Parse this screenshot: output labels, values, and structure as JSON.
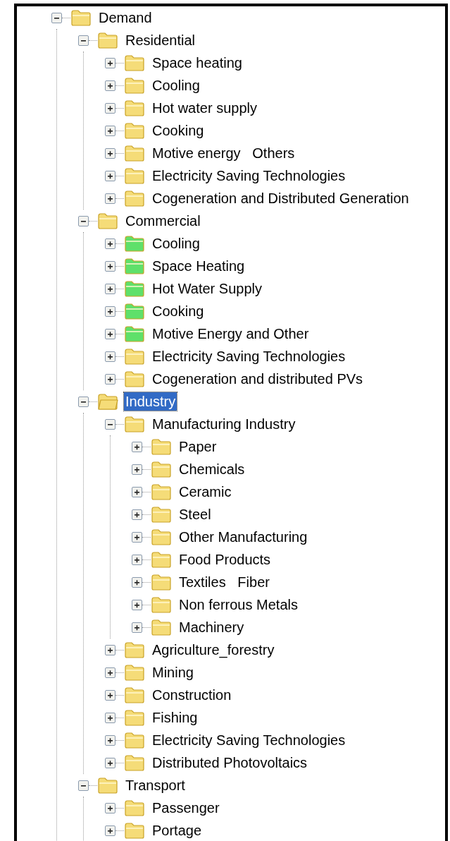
{
  "tree": [
    {
      "label": "Demand",
      "expanded": true,
      "selected": false,
      "color": "#f5dc78",
      "children": [
        {
          "label": "Residential",
          "expanded": true,
          "selected": false,
          "color": "#f5dc78",
          "children": [
            {
              "label": "Space heating",
              "expanded": false,
              "selected": false,
              "color": "#f5dc78"
            },
            {
              "label": "Cooling",
              "expanded": false,
              "selected": false,
              "color": "#f5dc78"
            },
            {
              "label": "Hot water supply",
              "expanded": false,
              "selected": false,
              "color": "#f5dc78"
            },
            {
              "label": "Cooking",
              "expanded": false,
              "selected": false,
              "color": "#f5dc78"
            },
            {
              "label": "Motive energy   Others",
              "expanded": false,
              "selected": false,
              "color": "#f5dc78"
            },
            {
              "label": "Electricity Saving Technologies",
              "expanded": false,
              "selected": false,
              "color": "#f5dc78"
            },
            {
              "label": "Cogeneration and Distributed Generation",
              "expanded": false,
              "selected": false,
              "color": "#f5dc78"
            }
          ]
        },
        {
          "label": "Commercial",
          "expanded": true,
          "selected": false,
          "color": "#f5dc78",
          "children": [
            {
              "label": "Cooling",
              "expanded": false,
              "selected": false,
              "color": "#5fe06a"
            },
            {
              "label": "Space Heating",
              "expanded": false,
              "selected": false,
              "color": "#5fe06a"
            },
            {
              "label": "Hot Water Supply",
              "expanded": false,
              "selected": false,
              "color": "#5fe06a"
            },
            {
              "label": "Cooking",
              "expanded": false,
              "selected": false,
              "color": "#5fe06a"
            },
            {
              "label": "Motive Energy and Other",
              "expanded": false,
              "selected": false,
              "color": "#5fe06a"
            },
            {
              "label": "Electricity Saving Technologies",
              "expanded": false,
              "selected": false,
              "color": "#f5dc78"
            },
            {
              "label": "Cogeneration and distributed PVs",
              "expanded": false,
              "selected": false,
              "color": "#f5dc78"
            }
          ]
        },
        {
          "label": "Industry",
          "expanded": true,
          "selected": true,
          "color": "#f5dc78",
          "children": [
            {
              "label": "Manufacturing Industry",
              "expanded": true,
              "selected": false,
              "color": "#f5dc78",
              "children": [
                {
                  "label": "Paper",
                  "expanded": false,
                  "selected": false,
                  "color": "#f5dc78"
                },
                {
                  "label": "Chemicals",
                  "expanded": false,
                  "selected": false,
                  "color": "#f5dc78"
                },
                {
                  "label": "Ceramic",
                  "expanded": false,
                  "selected": false,
                  "color": "#f5dc78"
                },
                {
                  "label": "Steel",
                  "expanded": false,
                  "selected": false,
                  "color": "#f5dc78"
                },
                {
                  "label": "Other Manufacturing",
                  "expanded": false,
                  "selected": false,
                  "color": "#f5dc78"
                },
                {
                  "label": "Food Products",
                  "expanded": false,
                  "selected": false,
                  "color": "#f5dc78"
                },
                {
                  "label": "Textiles   Fiber",
                  "expanded": false,
                  "selected": false,
                  "color": "#f5dc78"
                },
                {
                  "label": "Non ferrous Metals",
                  "expanded": false,
                  "selected": false,
                  "color": "#f5dc78"
                },
                {
                  "label": "Machinery",
                  "expanded": false,
                  "selected": false,
                  "color": "#f5dc78"
                }
              ]
            },
            {
              "label": "Agriculture_forestry",
              "expanded": false,
              "selected": false,
              "color": "#f5dc78"
            },
            {
              "label": "Mining",
              "expanded": false,
              "selected": false,
              "color": "#f5dc78"
            },
            {
              "label": "Construction",
              "expanded": false,
              "selected": false,
              "color": "#f5dc78"
            },
            {
              "label": "Fishing",
              "expanded": false,
              "selected": false,
              "color": "#f5dc78"
            },
            {
              "label": "Electricity Saving Technologies",
              "expanded": false,
              "selected": false,
              "color": "#f5dc78"
            },
            {
              "label": "Distributed Photovoltaics",
              "expanded": false,
              "selected": false,
              "color": "#f5dc78"
            }
          ]
        },
        {
          "label": "Transport",
          "expanded": true,
          "selected": false,
          "color": "#f5dc78",
          "children": [
            {
              "label": "Passenger",
              "expanded": false,
              "selected": false,
              "color": "#f5dc78"
            },
            {
              "label": "Portage",
              "expanded": false,
              "selected": false,
              "color": "#f5dc78"
            }
          ]
        }
      ]
    }
  ]
}
